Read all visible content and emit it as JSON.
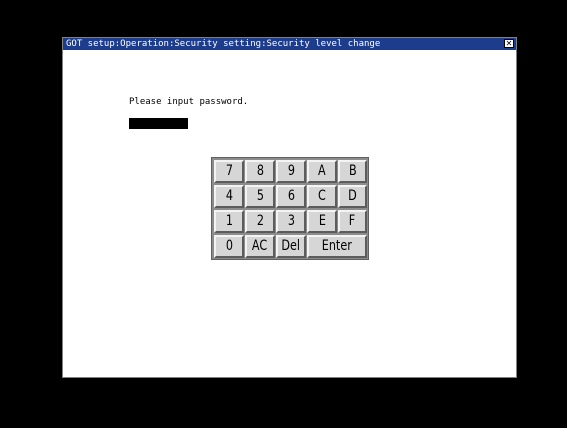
{
  "window": {
    "title": "GOT setup:Operation:Security setting:Security level change",
    "close_label": "✕"
  },
  "dialog": {
    "prompt": "Please input password.",
    "password_value": ""
  },
  "keypad": {
    "rows": [
      [
        "7",
        "8",
        "9",
        "A",
        "B"
      ],
      [
        "4",
        "5",
        "6",
        "C",
        "D"
      ],
      [
        "1",
        "2",
        "3",
        "E",
        "F"
      ],
      [
        "0",
        "AC",
        "Del",
        "Enter"
      ]
    ]
  },
  "colors": {
    "titlebar": "#1e3c8c",
    "background": "#000000",
    "window": "#ffffff",
    "key_face": "#d6d6d6"
  }
}
